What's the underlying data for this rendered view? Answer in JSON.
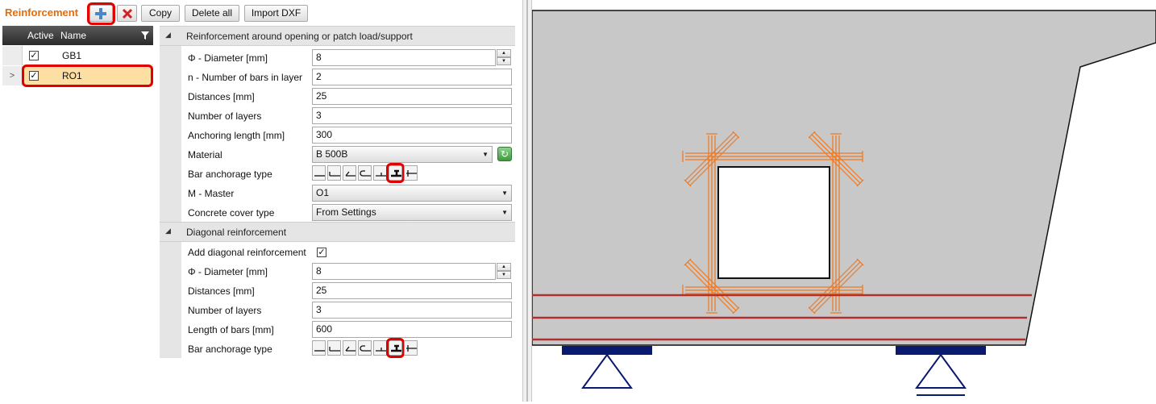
{
  "toolbar": {
    "title": "Reinforcement",
    "add_icon": "plus-icon",
    "delete_icon": "delete-x-icon",
    "copy_label": "Copy",
    "delete_all_label": "Delete all",
    "import_dxf_label": "Import DXF"
  },
  "grid": {
    "columns": [
      "Active",
      "Name"
    ],
    "filter_icon": "filter-icon",
    "rows": [
      {
        "active": true,
        "name": "GB1",
        "selected": false
      },
      {
        "active": true,
        "name": "RO1",
        "selected": true
      }
    ],
    "current_row_marker": ">"
  },
  "section_opening": {
    "title": "Reinforcement around opening or patch load/support",
    "fields": {
      "diameter_label": "Φ - Diameter [mm]",
      "diameter_value": "8",
      "bars_label": "n - Number of bars in layer",
      "bars_value": "2",
      "distances_label": "Distances [mm]",
      "distances_value": "25",
      "layers_label": "Number of layers",
      "layers_value": "3",
      "anchoring_label": "Anchoring length [mm]",
      "anchoring_value": "300",
      "material_label": "Material",
      "material_value": "B 500B",
      "anchorage_label": "Bar anchorage type",
      "master_label": "M - Master",
      "master_value": "O1",
      "cover_label": "Concrete cover type",
      "cover_value": "From Settings"
    },
    "anchorage_selected_index": 5
  },
  "section_diagonal": {
    "title": "Diagonal reinforcement",
    "fields": {
      "add_label": "Add diagonal reinforcement",
      "add_checked": true,
      "diameter_label": "Φ - Diameter [mm]",
      "diameter_value": "8",
      "distances_label": "Distances [mm]",
      "distances_value": "25",
      "layers_label": "Number of layers",
      "layers_value": "3",
      "length_label": "Length of bars [mm]",
      "length_value": "600",
      "anchorage_label": "Bar anchorage type"
    },
    "anchorage_selected_index": 5
  },
  "colors": {
    "accent": "#e36c0a",
    "highlight": "#e00000",
    "concrete": "#c8c8c8",
    "rebar_opening": "#f07820",
    "rebar_bottom": "#b03030",
    "support": "#0a1a6e"
  }
}
